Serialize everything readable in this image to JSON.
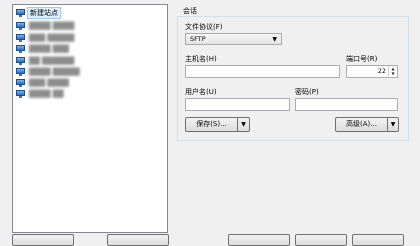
{
  "sites": {
    "items": [
      {
        "label": "新建站点",
        "selected": true
      },
      {
        "label": "████ ████",
        "blurred": true
      },
      {
        "label": "███ █████",
        "blurred": true
      },
      {
        "label": "████ ███",
        "blurred": true
      },
      {
        "label": "██ ██████",
        "blurred": true
      },
      {
        "label": "████ █████",
        "blurred": true
      },
      {
        "label": "███ ████",
        "blurred": true
      },
      {
        "label": "████ ██",
        "blurred": true
      }
    ]
  },
  "session": {
    "title": "会话",
    "protocol_label": "文件协议(F)",
    "protocol_value": "SFTP",
    "host_label": "主机名(H)",
    "host_value": "",
    "port_label": "端口号(R)",
    "port_value": "22",
    "user_label": "用户名(U)",
    "user_value": "",
    "password_label": "密码(P)",
    "password_value": "",
    "save_label": "保存(S)...",
    "advanced_label": "高级(A)..."
  }
}
